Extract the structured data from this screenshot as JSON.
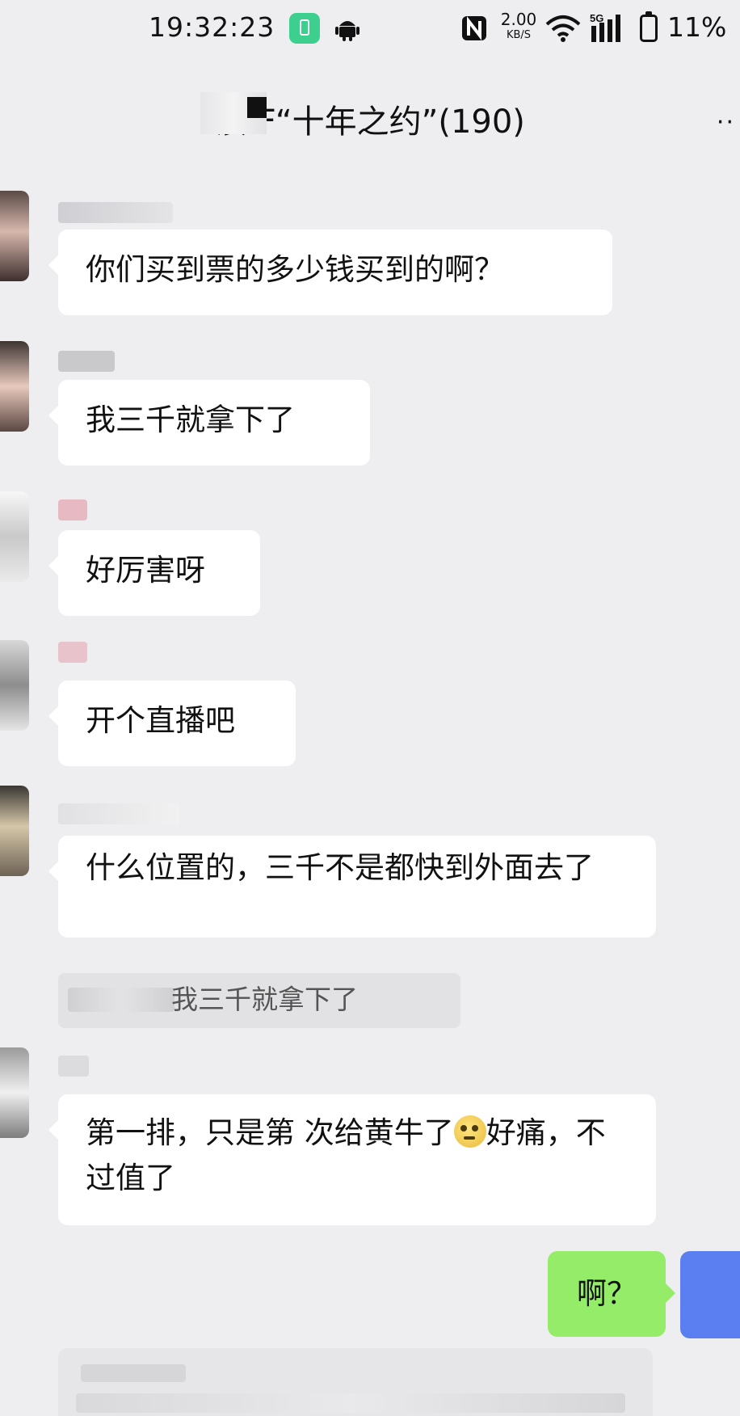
{
  "status_bar": {
    "time": "19:32:23",
    "net_speed_value": "2.00",
    "net_speed_unit": "KB/S",
    "network_type": "5G",
    "battery_percent": "11%"
  },
  "chat": {
    "title": "汝 F“十年之约”(190)",
    "more_label": "··"
  },
  "messages": [
    {
      "text": "你们买到票的多少钱买到的啊？"
    },
    {
      "text": "我三千就拿下了"
    },
    {
      "text": "好厉害呀"
    },
    {
      "text": "开个直播吧"
    },
    {
      "text": "什么位置的，三千不是都快到外面去了"
    },
    {
      "text_part1": "第一排，只是第 次给黄牛了",
      "text_part2": "好痛，不过值了"
    }
  ],
  "quote": {
    "text": "我三千就拿下了"
  },
  "self_message": {
    "text": "啊？"
  },
  "colors": {
    "background": "#eeeef0",
    "incoming_bubble": "#ffffff",
    "outgoing_bubble": "#95ec69",
    "self_avatar": "#5b7ff0"
  },
  "icons": [
    "battery-app-icon",
    "android-icon",
    "nfc-icon",
    "wifi-icon",
    "signal-icon",
    "battery-icon",
    "more-icon",
    "emoji-icon"
  ]
}
